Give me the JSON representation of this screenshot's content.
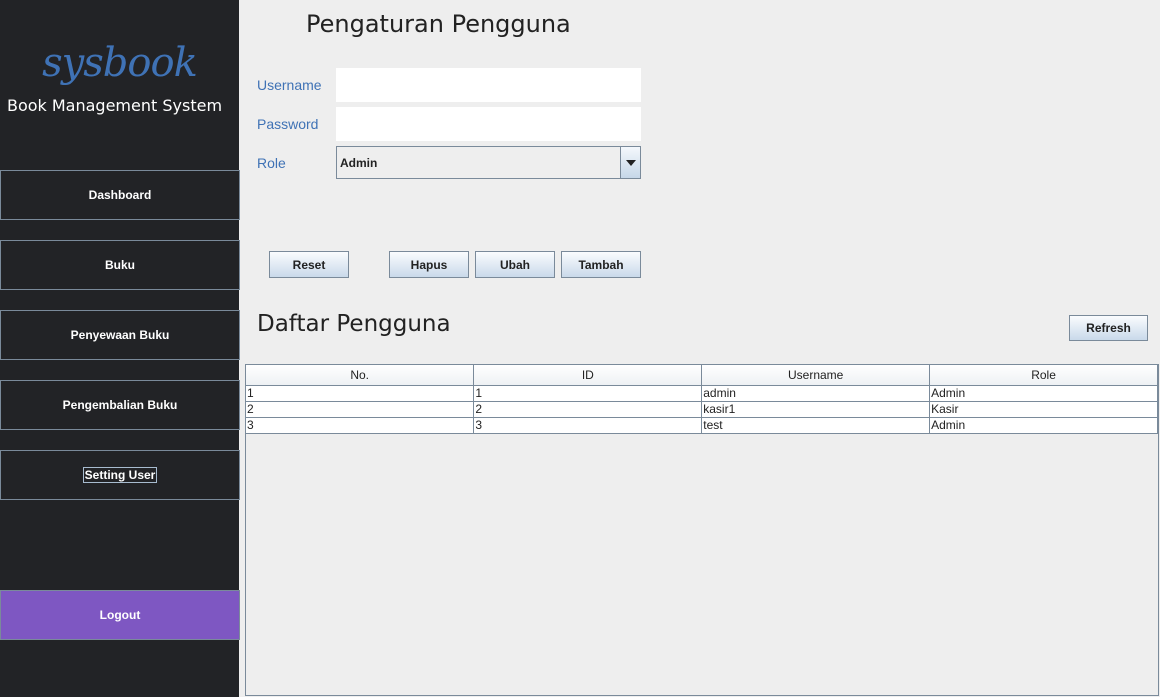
{
  "sidebar": {
    "logo": "sysbook",
    "subtitle": "Book Management System",
    "items": [
      {
        "label": "Dashboard"
      },
      {
        "label": "Buku"
      },
      {
        "label": "Penyewaan Buku"
      },
      {
        "label": "Pengembalian Buku"
      },
      {
        "label": "Setting User",
        "active": true
      }
    ],
    "logout": "Logout",
    "logout_color": "#7e57c2"
  },
  "form": {
    "title": "Pengaturan Pengguna",
    "username_label": "Username",
    "username_value": "",
    "password_label": "Password",
    "password_value": "",
    "role_label": "Role",
    "role_value": "Admin",
    "buttons": {
      "reset": "Reset",
      "delete": "Hapus",
      "edit": "Ubah",
      "add": "Tambah"
    }
  },
  "list": {
    "title": "Daftar Pengguna",
    "refresh": "Refresh",
    "columns": [
      "No.",
      "ID",
      "Username",
      "Role"
    ],
    "rows": [
      [
        "1",
        "1",
        "admin",
        "Admin"
      ],
      [
        "2",
        "2",
        "kasir1",
        "Kasir"
      ],
      [
        "3",
        "3",
        "test",
        "Admin"
      ]
    ]
  }
}
